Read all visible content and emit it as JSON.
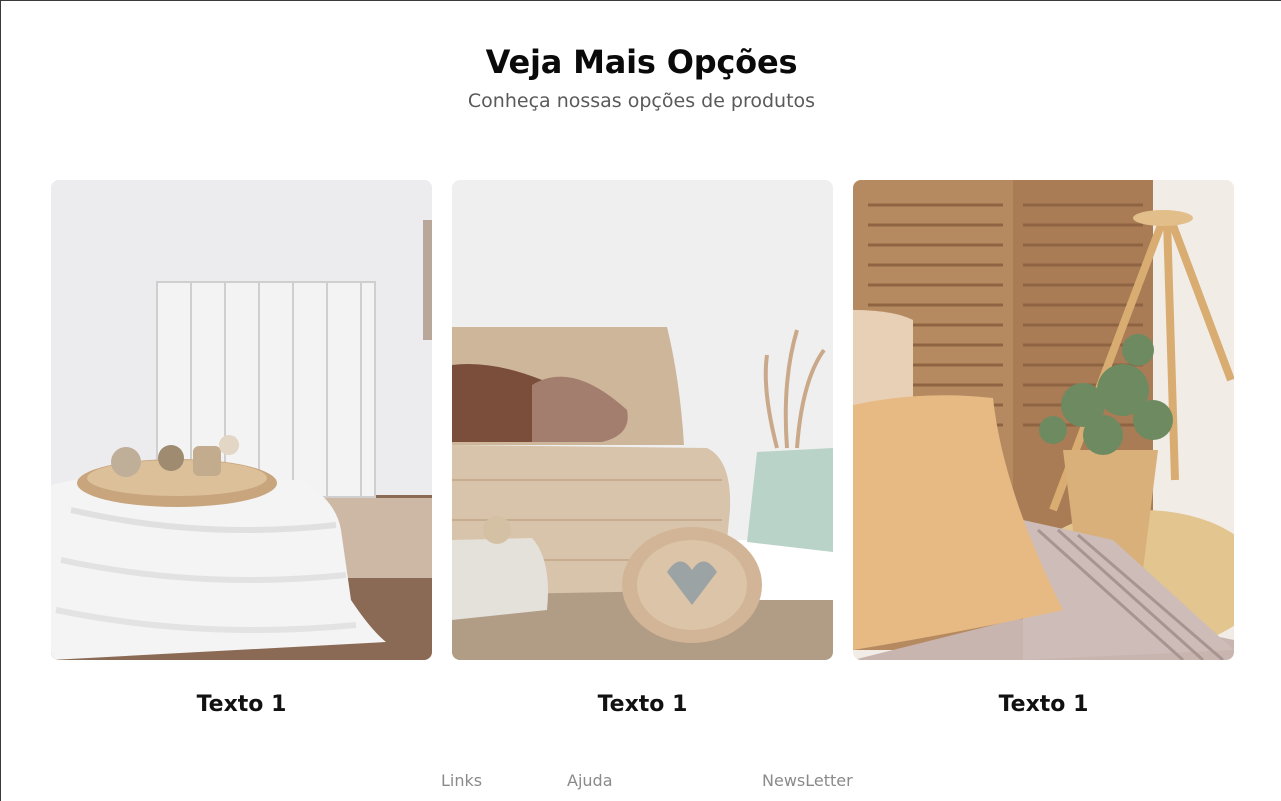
{
  "section": {
    "title": "Veja Mais Opções",
    "subtitle": "Conheça nossas opções de produtos"
  },
  "cards": [
    {
      "image_icon": "rustic-table-photo",
      "label": "Texto 1"
    },
    {
      "image_icon": "beige-sofa-photo",
      "label": "Texto 1"
    },
    {
      "image_icon": "rattan-plant-photo",
      "label": "Texto 1"
    }
  ],
  "footer": {
    "links": [
      "Links",
      "Ajuda",
      "NewsLetter"
    ]
  }
}
